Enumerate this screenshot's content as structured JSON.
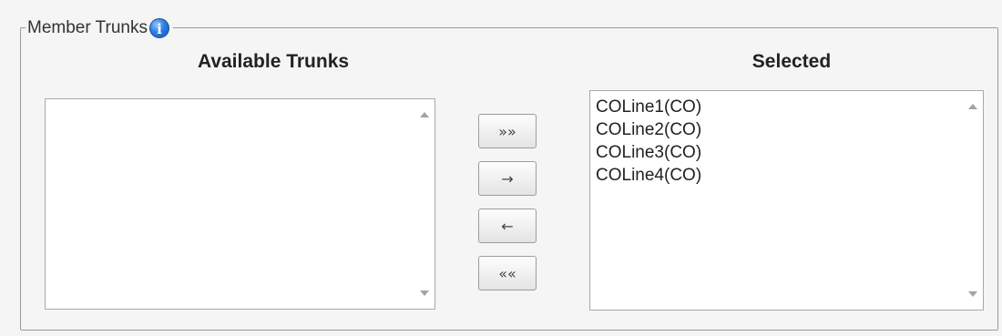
{
  "fieldset": {
    "legend": "Member Trunks",
    "info_icon": "i"
  },
  "available": {
    "header": "Available Trunks",
    "options": []
  },
  "selected": {
    "header": "Selected",
    "options": [
      "COLine1(CO)",
      "COLine2(CO)",
      "COLine3(CO)",
      "COLine4(CO)"
    ]
  },
  "buttons": {
    "add_all": "»»",
    "add": "→",
    "remove": "←",
    "remove_all": "««"
  },
  "icons": {
    "info": "info-icon",
    "scroll_up": "scroll-up-arrow-icon",
    "scroll_down": "scroll-down-arrow-icon"
  },
  "colors": {
    "info_icon": "#2d7fe0",
    "border": "#9a9a9a",
    "background": "#f5f5f5"
  }
}
